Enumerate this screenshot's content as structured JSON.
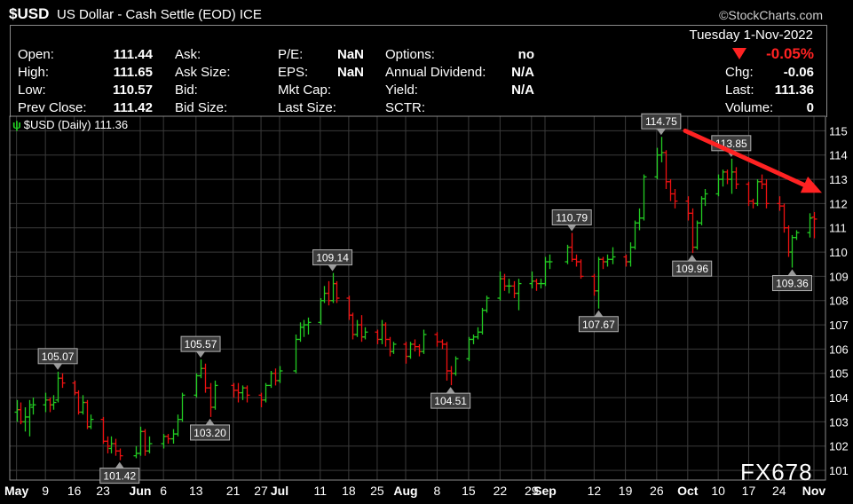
{
  "header": {
    "symbol": "$USD",
    "description": "US Dollar - Cash Settle (EOD) ICE",
    "brand": "©StockCharts.com"
  },
  "quote": {
    "open_label": "Open:",
    "open": "111.44",
    "high_label": "High:",
    "high": "111.65",
    "low_label": "Low:",
    "low": "110.57",
    "prev_label": "Prev Close:",
    "prev": "111.42",
    "ask_label": "Ask:",
    "asksize_label": "Ask Size:",
    "bid_label": "Bid:",
    "bidsize_label": "Bid Size:",
    "pe_label": "P/E:",
    "pe": "NaN",
    "eps_label": "EPS:",
    "eps": "NaN",
    "mktcap_label": "Mkt Cap:",
    "lastsize_label": "Last Size:",
    "options_label": "Options:",
    "options": "no",
    "div_label": "Annual Dividend:",
    "div": "N/A",
    "yield_label": "Yield:",
    "yield": "N/A",
    "sctr_label": "SCTR:",
    "date": "Tuesday  1-Nov-2022",
    "change_pct": "-0.05%",
    "chg_label": "Chg:",
    "chg": "-0.06",
    "last_label": "Last:",
    "last": "111.36",
    "volume_label": "Volume:",
    "volume": "0"
  },
  "series_label": "$USD (Daily) 111.36",
  "watermark": "FX678",
  "colors": {
    "up": "#22cc22",
    "down": "#ee1111",
    "grid": "#3a3a3a",
    "annot_bg": "#3c3c3c",
    "arrow": "#ff2222"
  },
  "chart_data": {
    "type": "ohlc",
    "ylim": [
      100.6,
      115.6
    ],
    "y_ticks": [
      101,
      102,
      103,
      104,
      105,
      106,
      107,
      108,
      109,
      110,
      111,
      112,
      113,
      114,
      115
    ],
    "x_labels": [
      "May",
      "9",
      "16",
      "23",
      "Jun",
      "6",
      "13",
      "21",
      "27",
      "Jul",
      "11",
      "18",
      "25",
      "Aug",
      "8",
      "15",
      "22",
      "29",
      "Sep",
      "12",
      "19",
      "26",
      "Oct",
      "10",
      "17",
      "24",
      "Nov"
    ],
    "x_label_dates": [
      "2022-05-02",
      "2022-05-09",
      "2022-05-16",
      "2022-05-23",
      "2022-06-01",
      "2022-06-06",
      "2022-06-13",
      "2022-06-21",
      "2022-06-27",
      "2022-07-01",
      "2022-07-11",
      "2022-07-18",
      "2022-07-25",
      "2022-08-01",
      "2022-08-08",
      "2022-08-15",
      "2022-08-22",
      "2022-08-29",
      "2022-09-01",
      "2022-09-12",
      "2022-09-19",
      "2022-09-26",
      "2022-10-03",
      "2022-10-10",
      "2022-10-17",
      "2022-10-24",
      "2022-11-01"
    ],
    "x_label_bold": [
      "May",
      "Jun",
      "Jul",
      "Aug",
      "Sep",
      "Oct",
      "Nov"
    ],
    "bars": [
      {
        "d": "2022-05-02",
        "o": 103.4,
        "h": 103.9,
        "l": 103.0,
        "c": 103.5
      },
      {
        "d": "2022-05-03",
        "o": 103.5,
        "h": 103.8,
        "l": 102.9,
        "c": 103.0
      },
      {
        "d": "2022-05-04",
        "o": 103.0,
        "h": 103.6,
        "l": 102.6,
        "c": 103.2
      },
      {
        "d": "2022-05-05",
        "o": 103.2,
        "h": 103.9,
        "l": 102.4,
        "c": 103.7
      },
      {
        "d": "2022-05-06",
        "o": 103.6,
        "h": 104.0,
        "l": 103.3,
        "c": 103.7
      },
      {
        "d": "2022-05-09",
        "o": 103.7,
        "h": 104.2,
        "l": 103.4,
        "c": 103.9
      },
      {
        "d": "2022-05-10",
        "o": 103.9,
        "h": 104.0,
        "l": 103.4,
        "c": 103.7
      },
      {
        "d": "2022-05-11",
        "o": 103.7,
        "h": 104.1,
        "l": 103.5,
        "c": 103.8
      },
      {
        "d": "2022-05-12",
        "o": 103.9,
        "h": 105.07,
        "l": 103.8,
        "c": 104.8
      },
      {
        "d": "2022-05-13",
        "o": 104.8,
        "h": 105.0,
        "l": 104.4,
        "c": 104.6
      },
      {
        "d": "2022-05-16",
        "o": 104.6,
        "h": 104.7,
        "l": 104.1,
        "c": 104.2
      },
      {
        "d": "2022-05-17",
        "o": 104.2,
        "h": 104.3,
        "l": 103.3,
        "c": 103.4
      },
      {
        "d": "2022-05-18",
        "o": 103.4,
        "h": 104.1,
        "l": 103.3,
        "c": 103.8
      },
      {
        "d": "2022-05-19",
        "o": 103.8,
        "h": 103.9,
        "l": 102.7,
        "c": 102.8
      },
      {
        "d": "2022-05-20",
        "o": 102.8,
        "h": 103.3,
        "l": 102.7,
        "c": 103.1
      },
      {
        "d": "2022-05-23",
        "o": 103.1,
        "h": 103.2,
        "l": 102.1,
        "c": 102.2
      },
      {
        "d": "2022-05-24",
        "o": 102.2,
        "h": 102.4,
        "l": 101.7,
        "c": 102.0
      },
      {
        "d": "2022-05-25",
        "o": 101.9,
        "h": 102.4,
        "l": 101.7,
        "c": 102.1
      },
      {
        "d": "2022-05-26",
        "o": 102.1,
        "h": 102.3,
        "l": 101.6,
        "c": 101.8
      },
      {
        "d": "2022-05-27",
        "o": 101.8,
        "h": 101.9,
        "l": 101.42,
        "c": 101.6
      },
      {
        "d": "2022-05-31",
        "o": 101.6,
        "h": 102.0,
        "l": 101.5,
        "c": 101.7
      },
      {
        "d": "2022-06-01",
        "o": 101.7,
        "h": 102.8,
        "l": 101.6,
        "c": 102.6
      },
      {
        "d": "2022-06-02",
        "o": 102.6,
        "h": 102.7,
        "l": 101.6,
        "c": 101.8
      },
      {
        "d": "2022-06-03",
        "o": 101.8,
        "h": 102.4,
        "l": 101.7,
        "c": 102.1
      },
      {
        "d": "2022-06-06",
        "o": 102.1,
        "h": 102.5,
        "l": 101.9,
        "c": 102.4
      },
      {
        "d": "2022-06-07",
        "o": 102.4,
        "h": 102.5,
        "l": 102.1,
        "c": 102.3
      },
      {
        "d": "2022-06-08",
        "o": 102.3,
        "h": 102.7,
        "l": 102.1,
        "c": 102.5
      },
      {
        "d": "2022-06-09",
        "o": 102.5,
        "h": 103.3,
        "l": 102.4,
        "c": 103.1
      },
      {
        "d": "2022-06-10",
        "o": 103.1,
        "h": 104.2,
        "l": 103.0,
        "c": 104.1
      },
      {
        "d": "2022-06-13",
        "o": 104.1,
        "h": 105.0,
        "l": 104.0,
        "c": 104.9
      },
      {
        "d": "2022-06-14",
        "o": 104.9,
        "h": 105.57,
        "l": 104.8,
        "c": 105.2
      },
      {
        "d": "2022-06-15",
        "o": 105.2,
        "h": 105.4,
        "l": 104.2,
        "c": 104.4
      },
      {
        "d": "2022-06-16",
        "o": 104.4,
        "h": 104.6,
        "l": 103.2,
        "c": 103.6
      },
      {
        "d": "2022-06-17",
        "o": 103.6,
        "h": 104.7,
        "l": 103.5,
        "c": 104.5
      },
      {
        "d": "2022-06-21",
        "o": 104.5,
        "h": 104.6,
        "l": 104.0,
        "c": 104.3
      },
      {
        "d": "2022-06-22",
        "o": 104.3,
        "h": 104.6,
        "l": 103.8,
        "c": 104.2
      },
      {
        "d": "2022-06-23",
        "o": 104.2,
        "h": 104.5,
        "l": 103.9,
        "c": 104.4
      },
      {
        "d": "2022-06-24",
        "o": 104.4,
        "h": 104.5,
        "l": 103.8,
        "c": 104.1
      },
      {
        "d": "2022-06-27",
        "o": 104.1,
        "h": 104.2,
        "l": 103.6,
        "c": 103.9
      },
      {
        "d": "2022-06-28",
        "o": 103.9,
        "h": 104.6,
        "l": 103.8,
        "c": 104.5
      },
      {
        "d": "2022-06-29",
        "o": 104.5,
        "h": 105.1,
        "l": 104.4,
        "c": 105.0
      },
      {
        "d": "2022-06-30",
        "o": 105.0,
        "h": 105.2,
        "l": 104.5,
        "c": 104.7
      },
      {
        "d": "2022-07-01",
        "o": 104.7,
        "h": 105.3,
        "l": 104.6,
        "c": 105.1
      },
      {
        "d": "2022-07-05",
        "o": 105.1,
        "h": 106.6,
        "l": 105.0,
        "c": 106.4
      },
      {
        "d": "2022-07-06",
        "o": 106.4,
        "h": 107.1,
        "l": 106.3,
        "c": 106.9
      },
      {
        "d": "2022-07-07",
        "o": 106.9,
        "h": 107.2,
        "l": 106.5,
        "c": 107.0
      },
      {
        "d": "2022-07-08",
        "o": 107.0,
        "h": 107.3,
        "l": 106.6,
        "c": 107.1
      },
      {
        "d": "2022-07-11",
        "o": 107.1,
        "h": 108.1,
        "l": 107.0,
        "c": 108.0
      },
      {
        "d": "2022-07-12",
        "o": 108.0,
        "h": 108.6,
        "l": 107.9,
        "c": 108.3
      },
      {
        "d": "2022-07-13",
        "o": 108.3,
        "h": 108.8,
        "l": 107.8,
        "c": 108.0
      },
      {
        "d": "2022-07-14",
        "o": 108.0,
        "h": 109.14,
        "l": 107.9,
        "c": 108.7
      },
      {
        "d": "2022-07-15",
        "o": 108.7,
        "h": 108.8,
        "l": 107.9,
        "c": 108.1
      },
      {
        "d": "2022-07-18",
        "o": 108.1,
        "h": 108.2,
        "l": 107.2,
        "c": 107.4
      },
      {
        "d": "2022-07-19",
        "o": 107.4,
        "h": 107.5,
        "l": 106.4,
        "c": 106.6
      },
      {
        "d": "2022-07-20",
        "o": 106.6,
        "h": 107.2,
        "l": 106.5,
        "c": 107.0
      },
      {
        "d": "2022-07-21",
        "o": 107.0,
        "h": 107.4,
        "l": 106.3,
        "c": 106.5
      },
      {
        "d": "2022-07-22",
        "o": 106.5,
        "h": 106.9,
        "l": 106.4,
        "c": 106.7
      },
      {
        "d": "2022-07-25",
        "o": 106.7,
        "h": 106.8,
        "l": 106.2,
        "c": 106.4
      },
      {
        "d": "2022-07-26",
        "o": 106.4,
        "h": 107.2,
        "l": 106.2,
        "c": 107.0
      },
      {
        "d": "2022-07-27",
        "o": 107.0,
        "h": 107.1,
        "l": 106.1,
        "c": 106.4
      },
      {
        "d": "2022-07-28",
        "o": 106.4,
        "h": 106.5,
        "l": 105.7,
        "c": 105.9
      },
      {
        "d": "2022-07-29",
        "o": 105.9,
        "h": 106.3,
        "l": 105.8,
        "c": 106.2
      },
      {
        "d": "2022-08-01",
        "o": 106.2,
        "h": 106.3,
        "l": 105.4,
        "c": 105.7
      },
      {
        "d": "2022-08-02",
        "o": 105.7,
        "h": 106.3,
        "l": 105.6,
        "c": 106.2
      },
      {
        "d": "2022-08-03",
        "o": 106.2,
        "h": 106.4,
        "l": 105.9,
        "c": 106.1
      },
      {
        "d": "2022-08-04",
        "o": 106.1,
        "h": 106.2,
        "l": 105.7,
        "c": 105.9
      },
      {
        "d": "2022-08-05",
        "o": 105.9,
        "h": 106.8,
        "l": 105.8,
        "c": 106.6
      },
      {
        "d": "2022-08-08",
        "o": 106.6,
        "h": 106.7,
        "l": 106.1,
        "c": 106.3
      },
      {
        "d": "2022-08-09",
        "o": 106.3,
        "h": 106.4,
        "l": 106.0,
        "c": 106.2
      },
      {
        "d": "2022-08-10",
        "o": 106.2,
        "h": 106.3,
        "l": 104.7,
        "c": 105.1
      },
      {
        "d": "2022-08-11",
        "o": 105.1,
        "h": 105.3,
        "l": 104.51,
        "c": 105.0
      },
      {
        "d": "2022-08-12",
        "o": 105.0,
        "h": 105.7,
        "l": 104.9,
        "c": 105.6
      },
      {
        "d": "2022-08-15",
        "o": 105.6,
        "h": 106.5,
        "l": 105.5,
        "c": 106.4
      },
      {
        "d": "2022-08-16",
        "o": 106.4,
        "h": 106.6,
        "l": 106.2,
        "c": 106.5
      },
      {
        "d": "2022-08-17",
        "o": 106.5,
        "h": 106.9,
        "l": 106.4,
        "c": 106.7
      },
      {
        "d": "2022-08-18",
        "o": 106.7,
        "h": 107.7,
        "l": 106.6,
        "c": 107.6
      },
      {
        "d": "2022-08-19",
        "o": 107.6,
        "h": 108.2,
        "l": 107.5,
        "c": 108.1
      },
      {
        "d": "2022-08-22",
        "o": 108.1,
        "h": 109.2,
        "l": 108.0,
        "c": 108.9
      },
      {
        "d": "2022-08-23",
        "o": 108.9,
        "h": 109.1,
        "l": 108.4,
        "c": 108.6
      },
      {
        "d": "2022-08-24",
        "o": 108.6,
        "h": 108.9,
        "l": 108.3,
        "c": 108.6
      },
      {
        "d": "2022-08-25",
        "o": 108.6,
        "h": 108.8,
        "l": 108.1,
        "c": 108.3
      },
      {
        "d": "2022-08-26",
        "o": 108.3,
        "h": 108.9,
        "l": 107.6,
        "c": 108.7
      },
      {
        "d": "2022-08-29",
        "o": 108.7,
        "h": 109.2,
        "l": 108.5,
        "c": 108.8
      },
      {
        "d": "2022-08-30",
        "o": 108.8,
        "h": 108.9,
        "l": 108.4,
        "c": 108.7
      },
      {
        "d": "2022-08-31",
        "o": 108.7,
        "h": 108.9,
        "l": 108.5,
        "c": 108.7
      },
      {
        "d": "2022-09-01",
        "o": 108.7,
        "h": 109.8,
        "l": 108.6,
        "c": 109.6
      },
      {
        "d": "2022-09-02",
        "o": 109.6,
        "h": 109.9,
        "l": 109.3,
        "c": 109.6
      },
      {
        "d": "2022-09-06",
        "o": 109.6,
        "h": 110.3,
        "l": 109.5,
        "c": 110.2
      },
      {
        "d": "2022-09-07",
        "o": 110.2,
        "h": 110.79,
        "l": 109.6,
        "c": 109.7
      },
      {
        "d": "2022-09-08",
        "o": 109.7,
        "h": 109.9,
        "l": 109.4,
        "c": 109.6
      },
      {
        "d": "2022-09-09",
        "o": 109.6,
        "h": 109.7,
        "l": 108.9,
        "c": 109.0
      },
      {
        "d": "2022-09-12",
        "o": 109.0,
        "h": 109.1,
        "l": 108.2,
        "c": 108.4
      },
      {
        "d": "2022-09-13",
        "o": 108.4,
        "h": 109.8,
        "l": 107.67,
        "c": 109.7
      },
      {
        "d": "2022-09-14",
        "o": 109.7,
        "h": 109.8,
        "l": 109.3,
        "c": 109.6
      },
      {
        "d": "2022-09-15",
        "o": 109.6,
        "h": 109.9,
        "l": 109.4,
        "c": 109.7
      },
      {
        "d": "2022-09-16",
        "o": 109.7,
        "h": 110.2,
        "l": 109.5,
        "c": 109.8
      },
      {
        "d": "2022-09-19",
        "o": 109.8,
        "h": 109.9,
        "l": 109.4,
        "c": 109.6
      },
      {
        "d": "2022-09-20",
        "o": 109.6,
        "h": 110.4,
        "l": 109.4,
        "c": 110.2
      },
      {
        "d": "2022-09-21",
        "o": 110.2,
        "h": 111.3,
        "l": 110.1,
        "c": 111.2
      },
      {
        "d": "2022-09-22",
        "o": 111.2,
        "h": 111.8,
        "l": 110.9,
        "c": 111.4
      },
      {
        "d": "2022-09-23",
        "o": 111.4,
        "h": 113.2,
        "l": 111.3,
        "c": 113.1
      },
      {
        "d": "2022-09-26",
        "o": 113.1,
        "h": 114.3,
        "l": 113.0,
        "c": 114.0
      },
      {
        "d": "2022-09-27",
        "o": 114.0,
        "h": 114.75,
        "l": 113.7,
        "c": 114.1
      },
      {
        "d": "2022-09-28",
        "o": 114.1,
        "h": 114.2,
        "l": 112.6,
        "c": 112.9
      },
      {
        "d": "2022-09-29",
        "o": 112.9,
        "h": 113.0,
        "l": 112.1,
        "c": 112.4
      },
      {
        "d": "2022-09-30",
        "o": 112.4,
        "h": 112.6,
        "l": 111.8,
        "c": 112.1
      },
      {
        "d": "2022-10-03",
        "o": 112.1,
        "h": 112.3,
        "l": 111.3,
        "c": 111.6
      },
      {
        "d": "2022-10-04",
        "o": 111.6,
        "h": 111.8,
        "l": 109.96,
        "c": 110.2
      },
      {
        "d": "2022-10-05",
        "o": 110.2,
        "h": 111.3,
        "l": 110.1,
        "c": 111.2
      },
      {
        "d": "2022-10-06",
        "o": 111.2,
        "h": 112.3,
        "l": 111.1,
        "c": 112.2
      },
      {
        "d": "2022-10-07",
        "o": 112.2,
        "h": 112.6,
        "l": 111.9,
        "c": 112.4
      },
      {
        "d": "2022-10-10",
        "o": 112.4,
        "h": 113.2,
        "l": 112.3,
        "c": 113.0
      },
      {
        "d": "2022-10-11",
        "o": 113.0,
        "h": 113.4,
        "l": 112.7,
        "c": 113.3
      },
      {
        "d": "2022-10-12",
        "o": 113.3,
        "h": 113.4,
        "l": 112.8,
        "c": 113.0
      },
      {
        "d": "2022-10-13",
        "o": 113.0,
        "h": 113.85,
        "l": 112.4,
        "c": 113.3
      },
      {
        "d": "2022-10-14",
        "o": 113.3,
        "h": 113.5,
        "l": 112.6,
        "c": 112.8
      },
      {
        "d": "2022-10-17",
        "o": 112.8,
        "h": 112.9,
        "l": 111.9,
        "c": 112.1
      },
      {
        "d": "2022-10-18",
        "o": 112.1,
        "h": 112.2,
        "l": 111.8,
        "c": 112.0
      },
      {
        "d": "2022-10-19",
        "o": 112.0,
        "h": 113.0,
        "l": 111.9,
        "c": 112.9
      },
      {
        "d": "2022-10-20",
        "o": 112.9,
        "h": 113.2,
        "l": 112.6,
        "c": 112.8
      },
      {
        "d": "2022-10-21",
        "o": 112.8,
        "h": 113.0,
        "l": 111.8,
        "c": 112.0
      },
      {
        "d": "2022-10-24",
        "o": 112.0,
        "h": 112.3,
        "l": 111.7,
        "c": 111.9
      },
      {
        "d": "2022-10-25",
        "o": 111.9,
        "h": 112.0,
        "l": 110.8,
        "c": 111.0
      },
      {
        "d": "2022-10-26",
        "o": 111.0,
        "h": 111.1,
        "l": 109.8,
        "c": 110.0
      },
      {
        "d": "2022-10-27",
        "o": 110.0,
        "h": 110.7,
        "l": 109.36,
        "c": 110.6
      },
      {
        "d": "2022-10-28",
        "o": 110.6,
        "h": 110.9,
        "l": 110.5,
        "c": 110.8
      },
      {
        "d": "2022-10-31",
        "o": 110.8,
        "h": 111.6,
        "l": 110.6,
        "c": 111.4
      },
      {
        "d": "2022-11-01",
        "o": 111.44,
        "h": 111.65,
        "l": 110.57,
        "c": 111.36
      }
    ],
    "annotations": [
      {
        "text": "105.07",
        "d": "2022-05-12",
        "v": 105.07,
        "pos": "above"
      },
      {
        "text": "101.42",
        "d": "2022-05-27",
        "v": 101.42,
        "pos": "below"
      },
      {
        "text": "105.57",
        "d": "2022-06-14",
        "v": 105.57,
        "pos": "above"
      },
      {
        "text": "103.20",
        "d": "2022-06-16",
        "v": 103.2,
        "pos": "below"
      },
      {
        "text": "109.14",
        "d": "2022-07-14",
        "v": 109.14,
        "pos": "above"
      },
      {
        "text": "104.51",
        "d": "2022-08-11",
        "v": 104.51,
        "pos": "below"
      },
      {
        "text": "110.79",
        "d": "2022-09-07",
        "v": 110.79,
        "pos": "above"
      },
      {
        "text": "107.67",
        "d": "2022-09-13",
        "v": 107.67,
        "pos": "below"
      },
      {
        "text": "114.75",
        "d": "2022-09-27",
        "v": 114.75,
        "pos": "above"
      },
      {
        "text": "109.96",
        "d": "2022-10-04",
        "v": 109.96,
        "pos": "below"
      },
      {
        "text": "113.85",
        "d": "2022-10-13",
        "v": 113.85,
        "pos": "above"
      },
      {
        "text": "109.36",
        "d": "2022-10-27",
        "v": 109.36,
        "pos": "below"
      }
    ],
    "trend_arrow": {
      "from": {
        "d": "2022-09-30",
        "v": 115.0
      },
      "to": {
        "d": "2022-11-01",
        "v": 112.3
      }
    }
  }
}
